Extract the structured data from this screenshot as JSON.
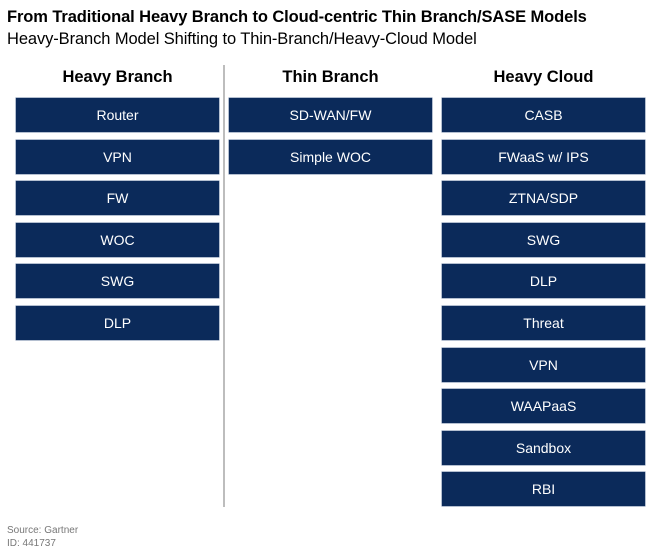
{
  "header": {
    "title": "From Traditional Heavy Branch to Cloud-centric Thin Branch/SASE Models",
    "subtitle": "Heavy-Branch Model Shifting to Thin-Branch/Heavy-Cloud Model"
  },
  "colors": {
    "box_fill": "#0b2a5a",
    "box_text": "#ffffff",
    "divider": "#bdbdbd"
  },
  "columns": [
    {
      "heading": "Heavy Branch",
      "items": [
        "Router",
        "VPN",
        "FW",
        "WOC",
        "SWG",
        "DLP"
      ]
    },
    {
      "heading": "Thin Branch",
      "items": [
        "SD-WAN/FW",
        "Simple WOC"
      ]
    },
    {
      "heading": "Heavy Cloud",
      "items": [
        "CASB",
        "FWaaS w/ IPS",
        "ZTNA/SDP",
        "SWG",
        "DLP",
        "Threat",
        "VPN",
        "WAAPaaS",
        "Sandbox",
        "RBI"
      ]
    }
  ],
  "footer": {
    "source": "Source: Gartner",
    "id": "ID: 441737"
  }
}
